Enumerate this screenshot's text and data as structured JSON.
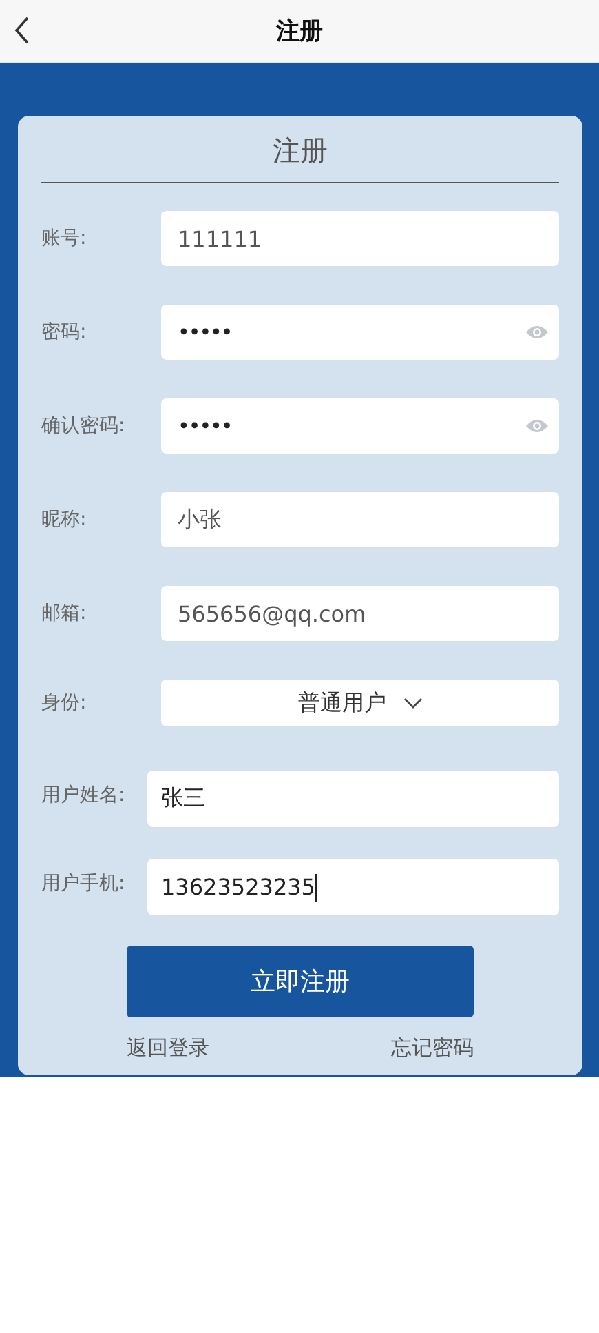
{
  "header": {
    "title": "注册"
  },
  "form": {
    "title": "注册",
    "fields": [
      {
        "kind": "text",
        "label": "账号:",
        "value": "111111"
      },
      {
        "kind": "password",
        "label": "密码:",
        "value": "•••••"
      },
      {
        "kind": "password",
        "label": "确认密码:",
        "value": "•••••"
      },
      {
        "kind": "text",
        "label": "昵称:",
        "value": "小张"
      },
      {
        "kind": "text",
        "label": "邮箱:",
        "value": "565656@qq.com"
      },
      {
        "kind": "select",
        "label": "身份:",
        "value": "普通用户"
      },
      {
        "kind": "plain",
        "label": "用户姓名:",
        "value": "张三",
        "focused": false
      },
      {
        "kind": "plain",
        "label": "用户手机:",
        "value": "13623523235",
        "focused": true
      }
    ],
    "submit": "立即注册",
    "links": [
      "返回登录",
      "忘记密码"
    ]
  }
}
